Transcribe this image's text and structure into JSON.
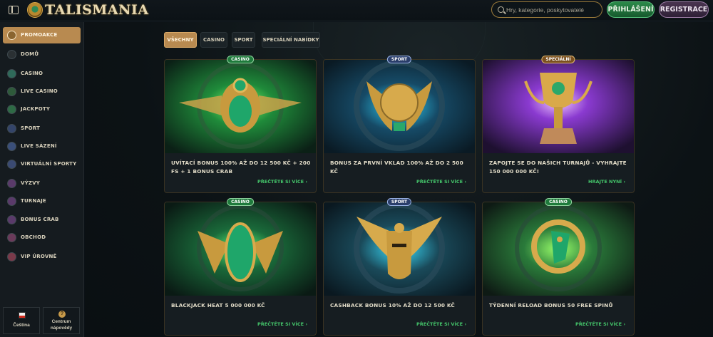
{
  "header": {
    "logo_text": "TALISMANIA",
    "search_placeholder": "Hry, kategorie, poskytovatelé",
    "login_label": "PŘIHLÁŠENÍ",
    "register_label": "REGISTRACE"
  },
  "sidebar": {
    "items": [
      {
        "label": "PROMOAKCE",
        "icon": "gift-icon",
        "active": true
      },
      {
        "label": "DOMŮ",
        "icon": "pyramid-icon",
        "active": false
      },
      {
        "label": "CASINO",
        "icon": "orb-icon",
        "active": false
      },
      {
        "label": "LIVE CASINO",
        "icon": "spade-icon",
        "active": false
      },
      {
        "label": "JACKPOTY",
        "icon": "clover-icon",
        "active": false
      },
      {
        "label": "SPORT",
        "icon": "ball-icon",
        "active": false
      },
      {
        "label": "LIVE SÁZENÍ",
        "icon": "live-icon",
        "active": false
      },
      {
        "label": "VIRTUÁLNÍ SPORTY",
        "icon": "gamepad-icon",
        "active": false
      },
      {
        "label": "VÝZVY",
        "icon": "challenge-icon",
        "active": false
      },
      {
        "label": "TURNAJE",
        "icon": "trophy-icon",
        "active": false
      },
      {
        "label": "BONUS CRAB",
        "icon": "crab-icon",
        "active": false
      },
      {
        "label": "OBCHOD",
        "icon": "shop-icon",
        "active": false
      },
      {
        "label": "VIP ÚROVNĚ",
        "icon": "diamond-icon",
        "active": false
      }
    ],
    "language_label": "Čeština",
    "help_line1": "Centrum",
    "help_line2": "nápovědy"
  },
  "filters": [
    {
      "label": "VŠECHNY",
      "active": true
    },
    {
      "label": "CASINO",
      "active": false
    },
    {
      "label": "SPORT",
      "active": false
    },
    {
      "label": "SPECIÁLNÍ NABÍDKY",
      "active": false
    }
  ],
  "promos": [
    {
      "badge": "CASINO",
      "badge_type": "casino",
      "title": "UVÍTACÍ BONUS 100% AŽ DO 12 500 KČ + 200 FS + 1 BONUS CRAB",
      "cta": "PŘEČTĚTE SI VÍCE",
      "art": "scarab-art"
    },
    {
      "badge": "SPORT",
      "badge_type": "sport",
      "title": "BONUS ZA PRVNÍ VKLAD 100% AŽ DO 2 500 KČ",
      "cta": "PŘEČTĚTE SI VÍCE",
      "art": "winged-ball-art"
    },
    {
      "badge": "SPECIÁLNÍ",
      "badge_type": "special",
      "title": "ZAPOJTE SE DO NAŠICH TURNAJŮ - VYHRAJTE 150 000 000 KČ!",
      "cta": "HRAJTE NYNÍ",
      "art": "trophy-art"
    },
    {
      "badge": "CASINO",
      "badge_type": "casino",
      "title": "BLACKJACK HEAT 5 000 000 KČ",
      "cta": "PŘEČTĚTE SI VÍCE",
      "art": "jackals-art"
    },
    {
      "badge": "SPORT",
      "badge_type": "sport",
      "title": "CASHBACK BONUS 10% AŽ DO 12 500 KČ",
      "cta": "PŘEČTĚTE SI VÍCE",
      "art": "pharaoh-art"
    },
    {
      "badge": "CASINO",
      "badge_type": "casino",
      "title": "TÝDENNÍ RELOAD BONUS 50 FREE SPINŮ",
      "cta": "PŘEČTĚTE SI VÍCE",
      "art": "horus-art"
    }
  ],
  "colors": {
    "accent_gold": "#b88a50",
    "login_green": "#2c8a4a",
    "cta_green": "#44c46a",
    "register_purple": "#4a3550"
  }
}
